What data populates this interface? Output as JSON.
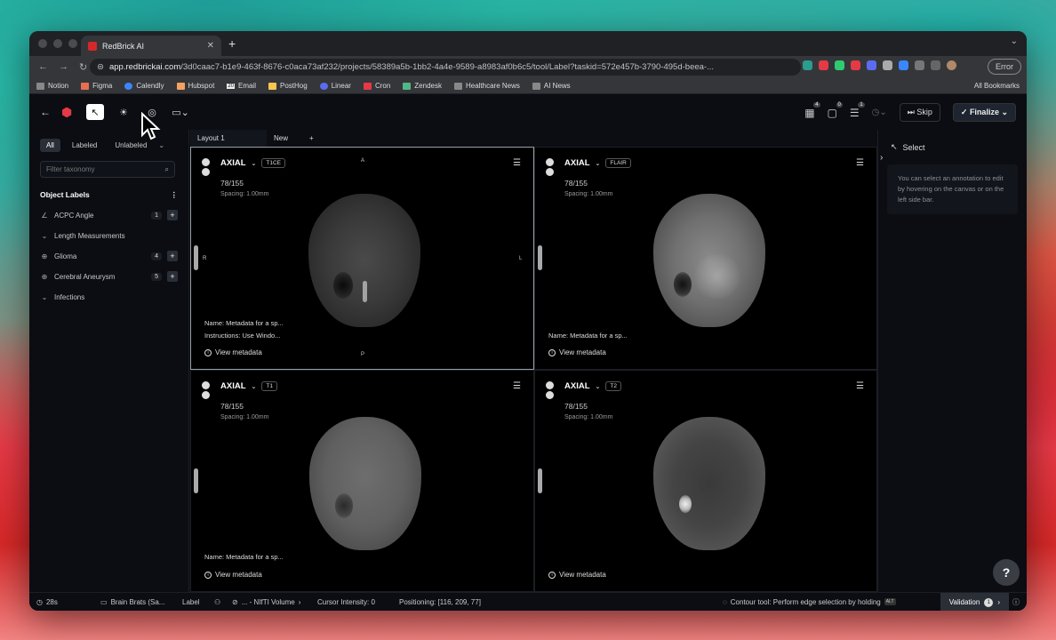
{
  "browser": {
    "tab_title": "RedBrick AI",
    "url_domain": "app.redbrickai.com",
    "url_path": "/3d0caac7-b1e9-463f-8676-c0aca73af232/projects/58389a5b-1bb2-4a4e-9589-a8983af0b6c5/tool/Label?taskid=572e457b-3790-495d-beea-...",
    "error_label": "Error",
    "bookmarks": [
      "Notion",
      "Figma",
      "Calendly",
      "Hubspot",
      "Email",
      "PostHog",
      "Linear",
      "Cron",
      "Zendesk",
      "Healthcare News",
      "AI News"
    ],
    "email_badge": "20",
    "all_bookmarks": "All Bookmarks"
  },
  "toolbar": {
    "badges": [
      "4",
      "0",
      "1"
    ],
    "skip_label": "Skip",
    "finalize_label": "Finalize"
  },
  "left": {
    "filters": [
      "All",
      "Labeled",
      "Unlabeled"
    ],
    "filter_placeholder": "Filter taxonomy",
    "object_labels_title": "Object Labels",
    "items": [
      {
        "label": "ACPC Angle",
        "count": "1",
        "plus": "+"
      },
      {
        "label": "Length Measurements",
        "count": "",
        "plus": ""
      },
      {
        "label": "Glioma",
        "count": "4",
        "plus": "+"
      },
      {
        "label": "Cerebral Aneurysm",
        "count": "5",
        "plus": "+"
      },
      {
        "label": "Infections",
        "count": "",
        "plus": ""
      }
    ]
  },
  "center": {
    "tabs": [
      "Layout 1",
      "New",
      "+"
    ],
    "viewports": [
      {
        "plane": "AXIAL",
        "seq": "T1CE",
        "slice": "78/155",
        "spacing": "Spacing: 1.00mm",
        "meta_name": "Name: Metadata for a sp...",
        "meta_instr": "Instructions: Use Windo...",
        "view_meta": "View metadata",
        "orient_top": "A",
        "orient_bottom": "P",
        "orient_left": "R",
        "orient_right": "L"
      },
      {
        "plane": "AXIAL",
        "seq": "FLAIR",
        "slice": "78/155",
        "spacing": "Spacing: 1.00mm",
        "meta_name": "Name: Metadata for a sp...",
        "view_meta": "View metadata"
      },
      {
        "plane": "AXIAL",
        "seq": "T1",
        "slice": "78/155",
        "spacing": "Spacing: 1.00mm",
        "meta_name": "Name: Metadata for a sp...",
        "view_meta": "View metadata"
      },
      {
        "plane": "AXIAL",
        "seq": "T2",
        "slice": "78/155",
        "spacing": "Spacing: 1.00mm",
        "view_meta": "View metadata"
      }
    ]
  },
  "right": {
    "title": "Select",
    "hint": "You can select an annotation to edit by hovering on the canvas or on the left side bar."
  },
  "status": {
    "timer": "28s",
    "dataset": "Brain Brats (Sa...",
    "stage": "Label",
    "volume": "... - NIfTI Volume",
    "cursor_intensity": "Cursor Intensity: 0",
    "positioning": "Positioning: [116, 209, 77]",
    "tip": "Contour tool: Perform edge selection by holding",
    "tip_key": "ALT",
    "validation": "Validation",
    "validation_count": "1"
  },
  "help_label": "?"
}
